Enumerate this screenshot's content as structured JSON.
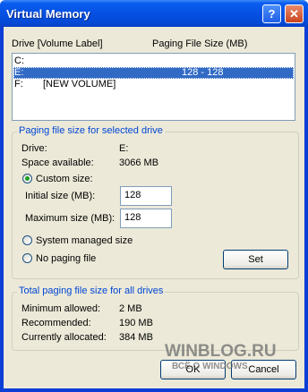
{
  "window": {
    "title": "Virtual Memory",
    "help_glyph": "?",
    "close_glyph": "✕"
  },
  "drives": {
    "col_drive": "Drive  [Volume Label]",
    "col_size": "Paging File Size (MB)",
    "rows": [
      {
        "drive": "C:",
        "label": "",
        "size": ""
      },
      {
        "drive": "E:",
        "label": "",
        "size": "128 - 128"
      },
      {
        "drive": "F:",
        "label": "[NEW VOLUME]",
        "size": ""
      }
    ]
  },
  "selected": {
    "group_title": "Paging file size for selected drive",
    "drive_label": "Drive:",
    "drive_value": "E:",
    "space_label": "Space available:",
    "space_value": "3066 MB",
    "custom_label": "Custom size:",
    "initial_label": "Initial size (MB):",
    "initial_value": "128",
    "max_label": "Maximum size (MB):",
    "max_value": "128",
    "system_label": "System managed size",
    "nopaging_label": "No paging file",
    "set_button": "Set"
  },
  "total": {
    "group_title": "Total paging file size for all drives",
    "min_label": "Minimum allowed:",
    "min_value": "2 MB",
    "rec_label": "Recommended:",
    "rec_value": "190 MB",
    "alloc_label": "Currently allocated:",
    "alloc_value": "384 MB"
  },
  "buttons": {
    "ok": "OK",
    "cancel": "Cancel"
  },
  "watermark": {
    "site": "WINBLOG.RU",
    "tagline": "ВСЁ О WINDOWS"
  },
  "colors": {
    "accent": "#0046d5",
    "selection": "#316ac5",
    "titlebar": "#0551e3"
  }
}
